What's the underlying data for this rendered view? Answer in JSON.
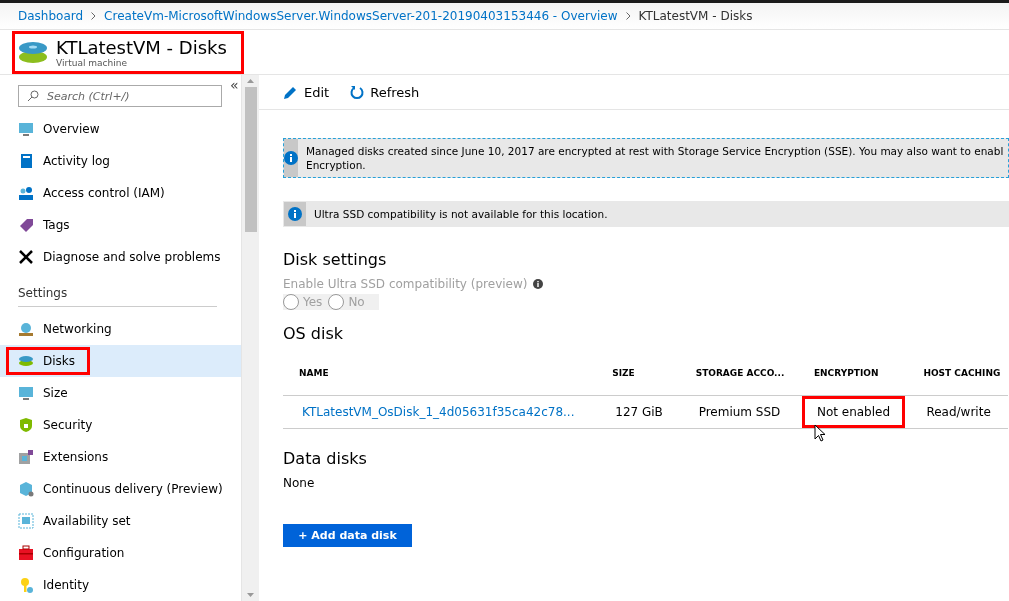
{
  "breadcrumb": [
    {
      "label": "Dashboard"
    },
    {
      "label": "CreateVm-MicrosoftWindowsServer.WindowsServer-201-20190403153446 - Overview"
    },
    {
      "label": "KTLatestVM - Disks"
    }
  ],
  "header": {
    "title": "KTLatestVM - Disks",
    "subtitle": "Virtual machine",
    "highlighted": true
  },
  "sidebar": {
    "collapse": "«",
    "search": {
      "placeholder": "Search (Ctrl+/)"
    },
    "groups": [
      {
        "items": [
          {
            "label": "Overview",
            "selected": false,
            "highlighted": false
          },
          {
            "label": "Activity log",
            "selected": false,
            "highlighted": false
          },
          {
            "label": "Access control (IAM)",
            "selected": false,
            "highlighted": false
          },
          {
            "label": "Tags",
            "selected": false,
            "highlighted": false
          },
          {
            "label": "Diagnose and solve problems",
            "selected": false,
            "highlighted": false
          }
        ]
      },
      {
        "heading": "Settings",
        "items": [
          {
            "label": "Networking",
            "selected": false,
            "highlighted": false
          },
          {
            "label": "Disks",
            "selected": true,
            "highlighted": true
          },
          {
            "label": "Size",
            "selected": false,
            "highlighted": false
          },
          {
            "label": "Security",
            "selected": false,
            "highlighted": false
          },
          {
            "label": "Extensions",
            "selected": false,
            "highlighted": false
          },
          {
            "label": "Continuous delivery (Preview)",
            "selected": false,
            "highlighted": false
          },
          {
            "label": "Availability set",
            "selected": false,
            "highlighted": false
          },
          {
            "label": "Configuration",
            "selected": false,
            "highlighted": false
          },
          {
            "label": "Identity",
            "selected": false,
            "highlighted": false
          }
        ]
      }
    ]
  },
  "toolbar": [
    {
      "label": "Edit",
      "kind": "edit"
    },
    {
      "label": "Refresh",
      "kind": "refresh"
    }
  ],
  "banners": [
    {
      "lines": [
        "Managed disks created since June 10, 2017 are encrypted at rest with Storage Service Encryption (SSE). You may also want to enabl",
        "Encryption."
      ],
      "focused": true
    },
    {
      "lines": [
        "Ultra SSD compatibility is not available for this location."
      ],
      "focused": false
    }
  ],
  "disk_settings": {
    "title": "Disk settings",
    "label": "Enable Ultra SSD compatibility (preview)",
    "disabled": true,
    "options": [
      {
        "label": "Yes",
        "selected": false
      },
      {
        "label": "No",
        "selected": false
      }
    ]
  },
  "os_disk": {
    "title": "OS disk",
    "columns": [
      "NAME",
      "SIZE",
      "STORAGE ACCO...",
      "ENCRYPTION",
      "HOST CACHING"
    ],
    "rows": [
      {
        "cells": [
          {
            "text": "KTLatestVM_OsDisk_1_4d05631f35ca42c78...",
            "link": true,
            "highlighted": false
          },
          {
            "text": "127 GiB",
            "link": false,
            "highlighted": false
          },
          {
            "text": "Premium SSD",
            "link": false,
            "highlighted": false
          },
          {
            "text": "Not enabled",
            "link": false,
            "highlighted": true
          },
          {
            "text": "Read/write",
            "link": false,
            "highlighted": false
          }
        ]
      }
    ]
  },
  "data_disks": {
    "title": "Data disks",
    "empty_text": "None",
    "add_button": "+ Add data disk"
  }
}
